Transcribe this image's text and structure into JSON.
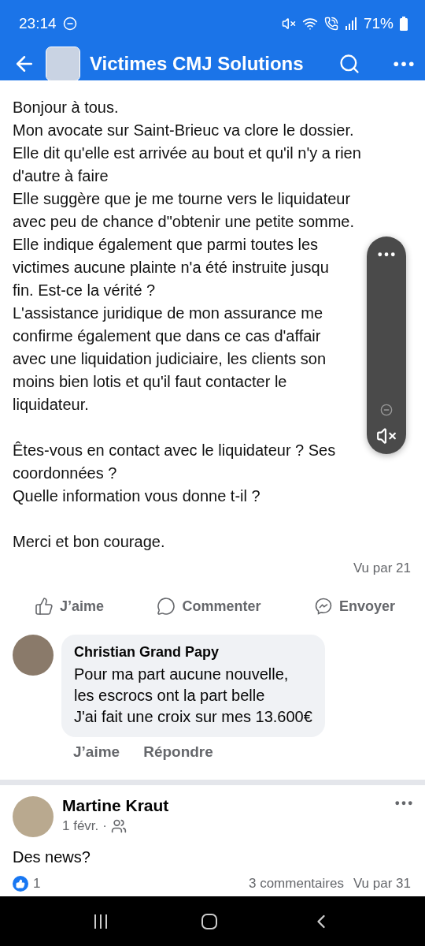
{
  "status_bar": {
    "time": "23:14",
    "battery": "71%"
  },
  "header": {
    "title": "Victimes CMJ Solutions"
  },
  "post": {
    "paragraphs": [
      [
        "Bonjour à tous.",
        "Mon avocate sur Saint-Brieuc va clore le dossier.",
        "Elle dit qu'elle est arrivée au bout et qu'il n'y a rien",
        "d'autre à faire",
        "Elle suggère que je me tourne vers le liquidateur",
        "avec peu de chance d\"obtenir une petite somme.",
        "Elle indique également que parmi toutes les",
        "victimes aucune plainte n'a été instruite jusqu",
        "fin. Est-ce la vérité ?",
        "L'assistance juridique de mon assurance me",
        "confirme également que dans ce cas d'affair",
        "avec une liquidation judiciaire, les clients son",
        "moins bien lotis et qu'il faut contacter le",
        "liquidateur."
      ],
      [
        "Êtes-vous en contact avec le liquidateur ? Ses",
        "coordonnées ?",
        "Quelle information vous donne t-il ?"
      ],
      [
        "Merci et bon courage."
      ]
    ],
    "views": "Vu par 21",
    "actions": [
      {
        "kind": "like",
        "label": "J’aime"
      },
      {
        "kind": "comment",
        "label": "Commenter"
      },
      {
        "kind": "send",
        "label": "Envoyer"
      }
    ]
  },
  "comment": {
    "author": "Christian Grand Papy",
    "lines": [
      "Pour ma part aucune nouvelle,",
      "les escrocs ont la part belle",
      "J'ai fait une croix sur mes 13.600€"
    ],
    "actions": [
      "J’aime",
      "Répondre"
    ]
  },
  "next_post": {
    "author": "Martine Kraut",
    "date": "1 févr.",
    "separator": "·",
    "text": "Des news?",
    "reactions": "1",
    "comments": "3 commentaires",
    "views": "Vu par 31"
  }
}
